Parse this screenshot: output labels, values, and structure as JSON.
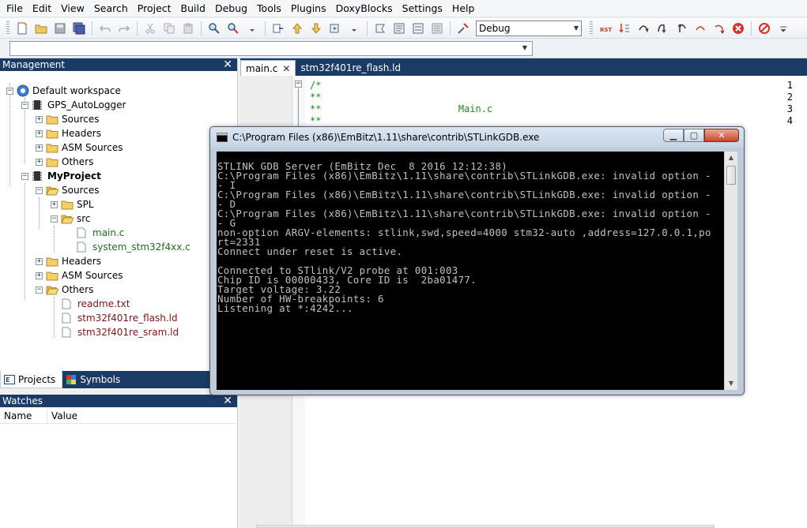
{
  "menu": [
    "File",
    "Edit",
    "View",
    "Search",
    "Project",
    "Build",
    "Debug",
    "Tools",
    "Plugins",
    "DoxyBlocks",
    "Settings",
    "Help"
  ],
  "toolbar": {
    "build_target": "Debug"
  },
  "management": {
    "title": "Management",
    "tree": {
      "workspace": "Default workspace",
      "project1": "GPS_AutoLogger",
      "p1_sources": "Sources",
      "p1_headers": "Headers",
      "p1_asm": "ASM Sources",
      "p1_others": "Others",
      "project2": "MyProject",
      "p2_sources": "Sources",
      "spl": "SPL",
      "src": "src",
      "main_c": "main.c",
      "system_c": "system_stm32f4xx.c",
      "p2_headers": "Headers",
      "p2_asm": "ASM Sources",
      "p2_others": "Others",
      "readme": "readme.txt",
      "flash_ld": "stm32f401re_flash.ld",
      "sram_ld": "stm32f401re_sram.ld"
    },
    "tabs": {
      "projects": "Projects",
      "symbols": "Symbols"
    }
  },
  "watches": {
    "title": "Watches",
    "col_name": "Name",
    "col_value": "Value"
  },
  "editor": {
    "tabs": {
      "main": "main.c",
      "flash": "stm32f401re_flash.ld"
    },
    "lines": [
      {
        "num": "1",
        "code": "/*"
      },
      {
        "num": "2",
        "code": "**"
      },
      {
        "num": "3",
        "code": "**                        Main.c"
      },
      {
        "num": "4",
        "code": "**"
      }
    ]
  },
  "console": {
    "title": "C:\\Program Files (x86)\\EmBitz\\1.11\\share\\contrib\\STLinkGDB.exe",
    "lines": [
      "STLINK GDB Server (EmBitz Dec  8 2016 12:12:38)",
      "C:\\Program Files (x86)\\EmBitz\\1.11\\share\\contrib\\STLinkGDB.exe: invalid option -",
      "- I",
      "C:\\Program Files (x86)\\EmBitz\\1.11\\share\\contrib\\STLinkGDB.exe: invalid option -",
      "- D",
      "C:\\Program Files (x86)\\EmBitz\\1.11\\share\\contrib\\STLinkGDB.exe: invalid option -",
      "- G",
      "non-option ARGV-elements: stlink,swd,speed=4000 stm32-auto ,address=127.0.0.1,po",
      "rt=2331",
      "Connect under reset is active.",
      "",
      "Connected to STlink/V2 probe at 001:003",
      "Chip ID is 00000433, Core ID is  2ba01477.",
      "Target voltage: 3.22",
      "Number of HW-breakpoints: 6",
      "Listening at *:4242..."
    ]
  }
}
